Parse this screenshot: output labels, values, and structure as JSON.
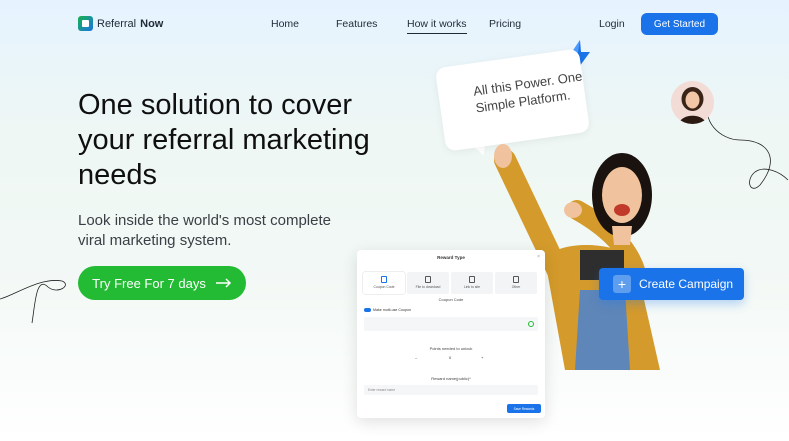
{
  "brand": {
    "name_light": "Referral",
    "name_bold": "Now"
  },
  "nav": {
    "links": [
      "Home",
      "Features",
      "How it works",
      "Pricing"
    ],
    "active": "How it works",
    "login": "Login",
    "cta": "Get Started"
  },
  "hero": {
    "title": "One solution to cover your referral marketing needs",
    "subtitle": "Look inside the world's most complete viral marketing system.",
    "cta": "Try Free For 7 days"
  },
  "bubble": {
    "text": "All this Power. One Simple Platform."
  },
  "modal": {
    "title": "Reward Type",
    "tabs": [
      "Coupon Code",
      "File to download",
      "Link to site",
      "Other"
    ],
    "section_label": "Coupon Code",
    "toggle_label": "Make multi-use Coupon",
    "points_label": "Points needed to unlock",
    "points_value": "0",
    "reward_label": "Reward name(public)*",
    "reward_placeholder": "Enter reward name",
    "save": "Save Rewards"
  },
  "create_campaign": "Create Campaign",
  "colors": {
    "primary": "#1a73e8",
    "green": "#22bb33"
  }
}
